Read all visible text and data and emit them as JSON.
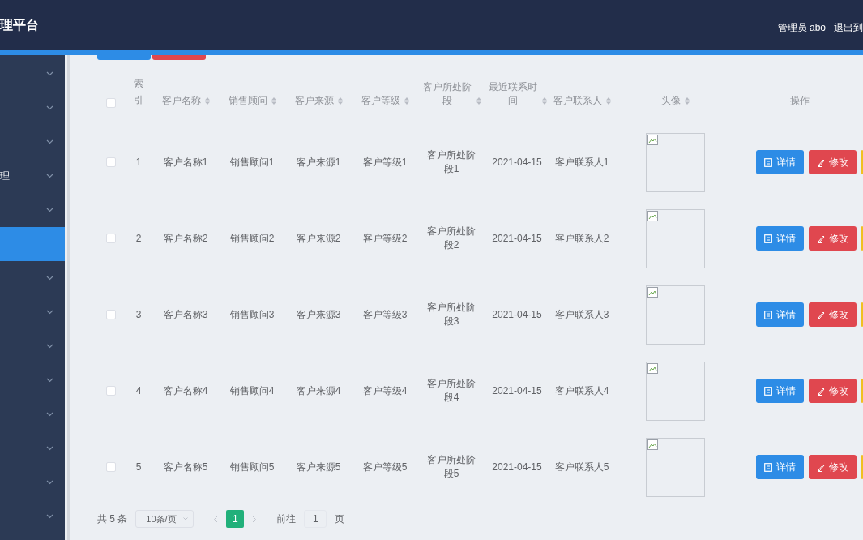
{
  "header": {
    "title": "理平台",
    "user": "管理员 abo",
    "logout": "退出到"
  },
  "toolbar": [
    {
      "kind": "primary"
    },
    {
      "kind": "danger"
    }
  ],
  "sidebar": {
    "items": [
      {
        "selected": false,
        "expandable": true
      },
      {
        "selected": false,
        "expandable": true
      },
      {
        "selected": false,
        "expandable": true
      },
      {
        "label": "理",
        "selected": false,
        "expandable": true
      },
      {
        "selected": false,
        "expandable": true
      },
      {
        "selected": true,
        "expandable": false
      },
      {
        "selected": false,
        "expandable": true
      },
      {
        "selected": false,
        "expandable": true
      },
      {
        "selected": false,
        "expandable": true
      },
      {
        "selected": false,
        "expandable": true
      },
      {
        "selected": false,
        "expandable": true
      },
      {
        "selected": false,
        "expandable": true
      },
      {
        "selected": false,
        "expandable": true
      },
      {
        "selected": false,
        "expandable": true
      }
    ]
  },
  "table": {
    "header_checked": false,
    "columns": [
      {
        "label": "索引",
        "sortable": false
      },
      {
        "label": "客户名称",
        "sortable": true
      },
      {
        "label": "销售顾问",
        "sortable": true
      },
      {
        "label": "客户来源",
        "sortable": true
      },
      {
        "label": "客户等级",
        "sortable": true
      },
      {
        "label": "客户所处阶段",
        "sortable": true
      },
      {
        "label": "最近联系时间",
        "sortable": true
      },
      {
        "label": "客户联系人",
        "sortable": true
      },
      {
        "label": "头像",
        "sortable": true
      },
      {
        "label": "操作",
        "sortable": false
      }
    ],
    "rows": [
      {
        "checked": false,
        "cells": [
          "1",
          "客户名称1",
          "销售顾问1",
          "客户来源1",
          "客户等级1",
          "客户所处阶段1",
          "2021-04-15",
          "客户联系人1"
        ],
        "avatar": {
          "kind": "broken-image"
        },
        "actions": [
          {
            "kind": "primary",
            "label": "详情"
          },
          {
            "kind": "danger",
            "label": "修改"
          },
          {
            "kind": "warning"
          }
        ]
      },
      {
        "checked": false,
        "cells": [
          "2",
          "客户名称2",
          "销售顾问2",
          "客户来源2",
          "客户等级2",
          "客户所处阶段2",
          "2021-04-15",
          "客户联系人2"
        ],
        "avatar": {
          "kind": "broken-image"
        },
        "actions": [
          {
            "kind": "primary",
            "label": "详情"
          },
          {
            "kind": "danger",
            "label": "修改"
          },
          {
            "kind": "warning"
          }
        ]
      },
      {
        "checked": false,
        "cells": [
          "3",
          "客户名称3",
          "销售顾问3",
          "客户来源3",
          "客户等级3",
          "客户所处阶段3",
          "2021-04-15",
          "客户联系人3"
        ],
        "avatar": {
          "kind": "broken-image"
        },
        "actions": [
          {
            "kind": "primary",
            "label": "详情"
          },
          {
            "kind": "danger",
            "label": "修改"
          },
          {
            "kind": "warning"
          }
        ]
      },
      {
        "checked": false,
        "cells": [
          "4",
          "客户名称4",
          "销售顾问4",
          "客户来源4",
          "客户等级4",
          "客户所处阶段4",
          "2021-04-15",
          "客户联系人4"
        ],
        "avatar": {
          "kind": "broken-image"
        },
        "actions": [
          {
            "kind": "primary",
            "label": "详情"
          },
          {
            "kind": "danger",
            "label": "修改"
          },
          {
            "kind": "warning"
          }
        ]
      },
      {
        "checked": false,
        "cells": [
          "5",
          "客户名称5",
          "销售顾问5",
          "客户来源5",
          "客户等级5",
          "客户所处阶段5",
          "2021-04-15",
          "客户联系人5"
        ],
        "avatar": {
          "kind": "broken-image"
        },
        "actions": [
          {
            "kind": "primary",
            "label": "详情"
          },
          {
            "kind": "danger",
            "label": "修改"
          },
          {
            "kind": "warning"
          }
        ]
      }
    ]
  },
  "pagination": {
    "total": "共 5 条",
    "page_size": "10条/页",
    "pages": [
      {
        "label": "1",
        "selected": true
      }
    ],
    "goto_label": "前往",
    "goto_value": "1",
    "goto_suffix": "页"
  }
}
